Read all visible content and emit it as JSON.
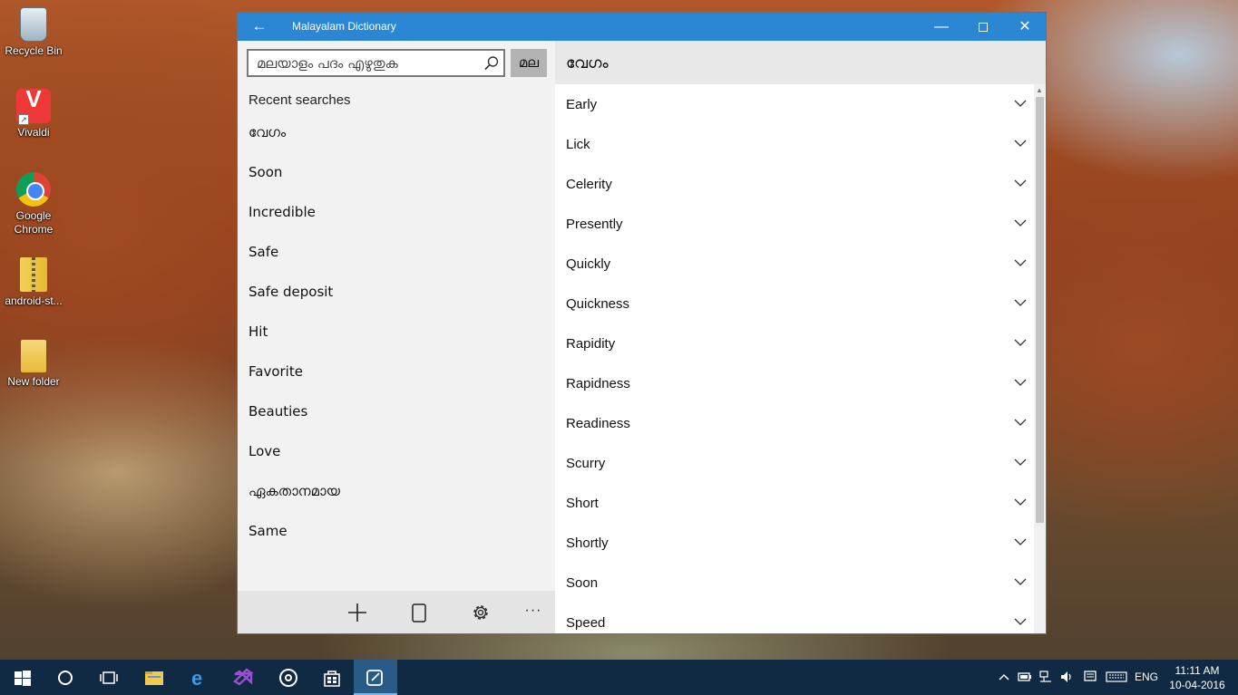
{
  "desktop": {
    "icons": [
      {
        "label": "Recycle Bin",
        "icon": "recycle-bin-icon"
      },
      {
        "label": "Vivaldi",
        "icon": "vivaldi-icon"
      },
      {
        "label": "Google Chrome",
        "icon": "chrome-icon"
      },
      {
        "label": "android-st...",
        "icon": "zip-folder-icon"
      },
      {
        "label": "New folder",
        "icon": "folder-icon"
      }
    ]
  },
  "window": {
    "title": "Malayalam Dictionary",
    "accent_color": "#2b86d4"
  },
  "search": {
    "placeholder": "മലയാളം പദം എഴുതുക",
    "value": "",
    "lang_button": "മല"
  },
  "recent": {
    "title": "Recent searches",
    "items": [
      "വേഗം",
      "Soon",
      "Incredible",
      "Safe",
      "Safe deposit",
      "Hit",
      "Favorite",
      "Beauties",
      "Love",
      "ഏകതാനമായ",
      "Same"
    ]
  },
  "result": {
    "word": "വേഗം",
    "meanings": [
      "Early",
      "Lick",
      "Celerity",
      "Presently",
      "Quickly",
      "Quickness",
      "Rapidity",
      "Rapidness",
      "Readiness",
      "Scurry",
      "Short",
      "Shortly",
      "Soon",
      "Speed"
    ]
  },
  "taskbar": {
    "items": [
      "windows-start-icon",
      "cortana-icon",
      "task-view-icon",
      "file-explorer-icon",
      "edge-icon",
      "visual-studio-icon",
      "groove-music-icon",
      "store-icon",
      "dictionary-app-icon"
    ],
    "language": "ENG",
    "time": "11:11 AM",
    "date": "10-04-2016"
  }
}
